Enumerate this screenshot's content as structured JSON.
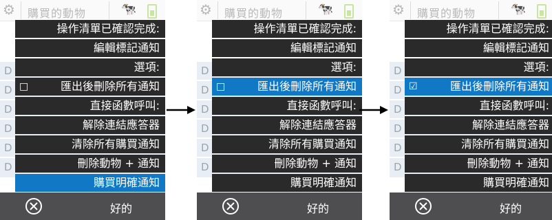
{
  "background": {
    "title": "購買的動物",
    "row_letter": "D"
  },
  "dialog": {
    "items": [
      "操作清單已確認完成:",
      "編輯標記通知",
      "選項:",
      "匯出後刪除所有通知",
      "直接函數呼叫:",
      "解除連結應答器",
      "清除所有購買通知",
      "刪除動物 + 通知",
      "購買明確通知"
    ],
    "ok_label": "好的"
  },
  "states": [
    {
      "checkbox": "□",
      "highlighted_index": 8
    },
    {
      "checkbox": "□",
      "highlighted_index": 3
    },
    {
      "checkbox": "☑",
      "highlighted_index": 3
    }
  ],
  "colors": {
    "item_bg": "#2a2a2a",
    "highlight": "#1178c6",
    "bottom_bar": "#4e4e50"
  },
  "icons": [
    "cancel-circle-x-icon",
    "arrow-right-icon",
    "animal-icon",
    "battery-icon"
  ]
}
